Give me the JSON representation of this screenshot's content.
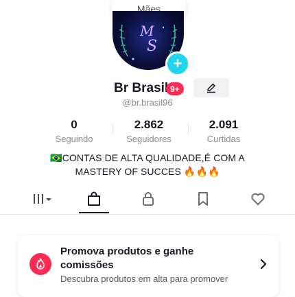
{
  "tooltip": {
    "text": "Mães"
  },
  "profile": {
    "name": "Br Brasil",
    "notification_badge": "9+",
    "handle": "@br.brasil96",
    "avatar_monogram": "MS"
  },
  "stats": [
    {
      "value": "0",
      "label": "Seguindo"
    },
    {
      "value": "2.862",
      "label": "Seguidores"
    },
    {
      "value": "2.091",
      "label": "Curtidas"
    }
  ],
  "bio": {
    "flag": "🇧🇷",
    "line1": "CONTAS DE ALTA QUALIDADE,É COM A",
    "line2": "MASTERY OF SUCCES",
    "emoji": "🔥🔥🔥"
  },
  "tabs": [
    {
      "icon": "grid-icon",
      "active": false
    },
    {
      "icon": "shopping-bag-icon",
      "active": true
    },
    {
      "icon": "lock-icon",
      "active": false
    },
    {
      "icon": "bookmark-icon",
      "active": false
    },
    {
      "icon": "heart-icon",
      "active": false
    }
  ],
  "promo": {
    "icon": "flame-icon",
    "title": "Promova produtos e ganhe comissões",
    "subtitle": "Descubra produtos em alta para promover"
  },
  "colors": {
    "accent_pink": "#fe2c55",
    "accent_cyan": "#20d5ec",
    "text_primary": "#161823",
    "text_secondary": "#8a8b91"
  }
}
